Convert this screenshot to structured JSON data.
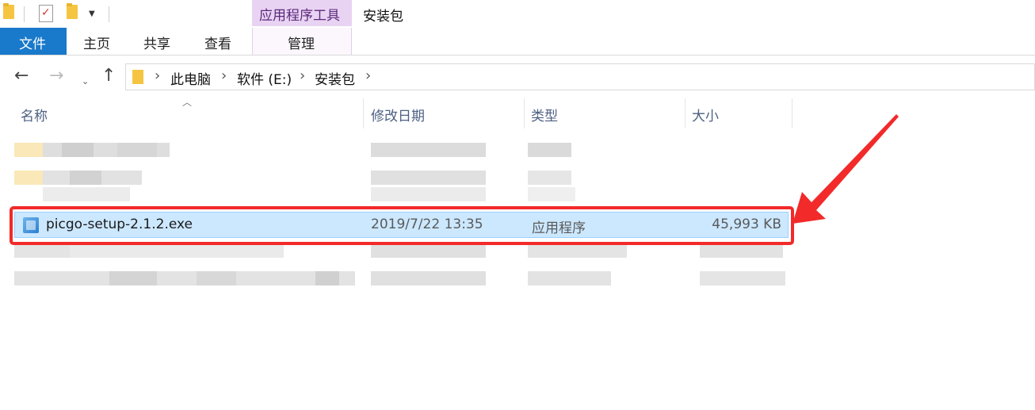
{
  "quick_access": {
    "icons": [
      "folder-icon",
      "properties-icon",
      "new-folder-icon",
      "dropdown-icon"
    ]
  },
  "context_tab": {
    "group_label": "应用程序工具"
  },
  "window": {
    "title": "安装包"
  },
  "ribbon": {
    "tabs": [
      {
        "label": "文件",
        "active": true
      },
      {
        "label": "主页"
      },
      {
        "label": "共享"
      },
      {
        "label": "查看"
      },
      {
        "label": "管理"
      }
    ]
  },
  "navigation": {
    "back_icon": "arrow-left-icon",
    "forward_icon": "arrow-right-icon",
    "recent_icon": "chevron-down-icon",
    "up_icon": "arrow-up-icon"
  },
  "breadcrumb": {
    "items": [
      "此电脑",
      "软件 (E:)",
      "安装包"
    ]
  },
  "columns": {
    "name": "名称",
    "date": "修改日期",
    "type": "类型",
    "size": "大小"
  },
  "selected_file": {
    "name": "picgo-setup-2.1.2.exe",
    "date": "2019/7/22 13:35",
    "type": "应用程序",
    "size": "45,993 KB"
  },
  "colors": {
    "accent": "#1979ca",
    "selection": "#cce8ff",
    "annotation": "#f22a2a",
    "context_tab": "#e9d3f3"
  }
}
